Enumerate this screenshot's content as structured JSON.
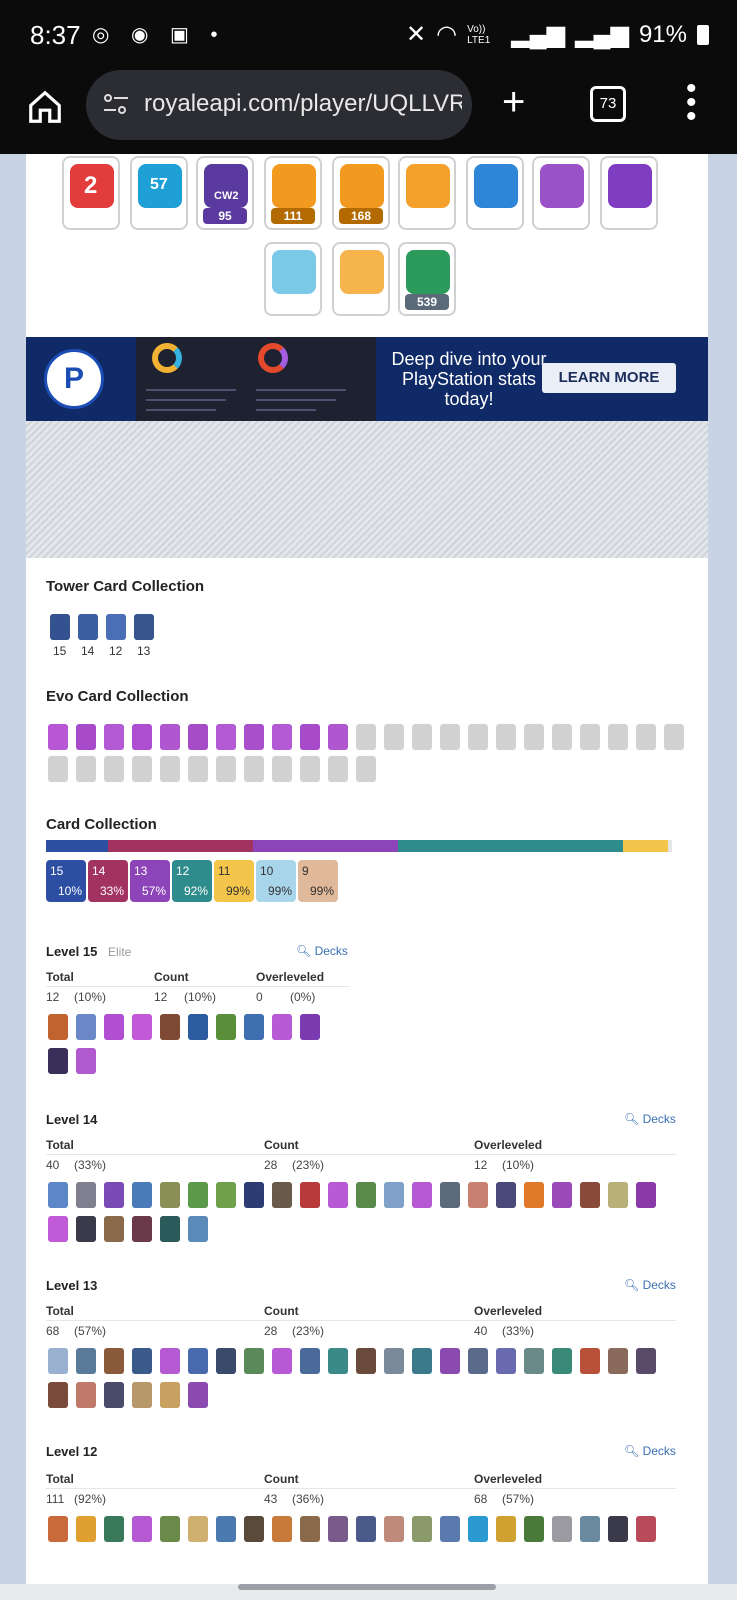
{
  "status": {
    "time": "8:37",
    "left_icons": [
      "chrome-icon",
      "messenger-icon",
      "gallery-icon",
      "dot-icon"
    ],
    "right_icons": [
      "mute-icon",
      "wifi-icon",
      "volte-icon",
      "signal-icon",
      "signal-icon"
    ],
    "volte": "Vo)) LTE1",
    "battery": "91%"
  },
  "browser": {
    "url": "royaleapi.com/player/UQLLVR",
    "tab_count": "73"
  },
  "badges": [
    {
      "num": "",
      "label": "2",
      "color": "#e23c3c"
    },
    {
      "num": "",
      "label": "57",
      "color": "#1ea0d6"
    },
    {
      "num": "95",
      "label": "CW2",
      "color": "#5a3a9f"
    },
    {
      "num": "111",
      "label": "",
      "color": "#f29a1f"
    },
    {
      "num": "168",
      "label": "",
      "color": "#f29a1f"
    },
    {
      "num": "",
      "label": "",
      "color": "#ffffff"
    },
    {
      "num": "",
      "label": "",
      "color": "#ffffff"
    },
    {
      "num": "",
      "label": "",
      "color": "#ffffff"
    },
    {
      "num": "",
      "label": "",
      "color": "#ffffff"
    },
    {
      "num": "",
      "label": "",
      "color": "#ffffff"
    },
    {
      "num": "",
      "label": "",
      "color": "#ffffff"
    },
    {
      "num": "539",
      "label": "",
      "color": "#ffffff"
    }
  ],
  "promo": {
    "headline": "Deep dive into your PlayStation stats today!",
    "button": "LEARN MORE"
  },
  "tower": {
    "title": "Tower Card Collection",
    "levels": [
      "15",
      "14",
      "12",
      "13"
    ]
  },
  "evo": {
    "title": "Evo Card Collection"
  },
  "collection": {
    "title": "Card Collection",
    "pills": [
      {
        "level": "15",
        "pct": "10%",
        "bg": "#2d4fa3",
        "fg": "#ffffff"
      },
      {
        "level": "14",
        "pct": "33%",
        "bg": "#a2325f",
        "fg": "#ffffff"
      },
      {
        "level": "13",
        "pct": "57%",
        "bg": "#8c44b8",
        "fg": "#ffffff"
      },
      {
        "level": "12",
        "pct": "92%",
        "bg": "#2f8c8c",
        "fg": "#ffffff"
      },
      {
        "level": "11",
        "pct": "99%",
        "bg": "#f4c54b",
        "fg": "#333333"
      },
      {
        "level": "10",
        "pct": "99%",
        "bg": "#a9d5ea",
        "fg": "#333333"
      },
      {
        "level": "9",
        "pct": "99%",
        "bg": "#e0b89a",
        "fg": "#333333"
      }
    ]
  },
  "levels": [
    {
      "title": "Level 15",
      "tag": "Elite",
      "decks": "Decks",
      "total_label": "Total",
      "count_label": "Count",
      "over_label": "Overleveled",
      "total": "12",
      "total_pct": "(10%)",
      "count": "12",
      "count_pct": "(10%)",
      "over": "0",
      "over_pct": "(0%)"
    },
    {
      "title": "Level 14",
      "tag": "",
      "decks": "Decks",
      "total_label": "Total",
      "count_label": "Count",
      "over_label": "Overleveled",
      "total": "40",
      "total_pct": "(33%)",
      "count": "28",
      "count_pct": "(23%)",
      "over": "12",
      "over_pct": "(10%)"
    },
    {
      "title": "Level 13",
      "tag": "",
      "decks": "Decks",
      "total_label": "Total",
      "count_label": "Count",
      "over_label": "Overleveled",
      "total": "68",
      "total_pct": "(57%)",
      "count": "28",
      "count_pct": "(23%)",
      "over": "40",
      "over_pct": "(33%)"
    },
    {
      "title": "Level 12",
      "tag": "",
      "decks": "Decks",
      "total_label": "Total",
      "count_label": "Count",
      "over_label": "Overleveled",
      "total": "111",
      "total_pct": "(92%)",
      "count": "43",
      "count_pct": "(36%)",
      "over": "68",
      "over_pct": "(57%)"
    }
  ]
}
